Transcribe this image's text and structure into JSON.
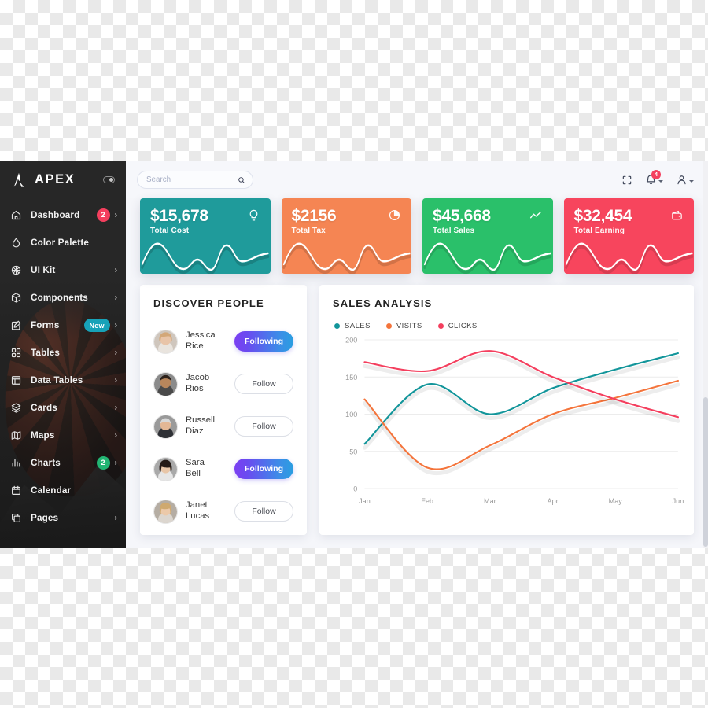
{
  "sidebar": {
    "brand": "APEX",
    "brand_icon": "apex-a-logo",
    "toggle_icon": "sidebar-toggle-switch",
    "items": [
      {
        "label": "Dashboard",
        "icon": "home-icon",
        "badge": "2",
        "badge_color": "#f43f5e",
        "chevron": "›"
      },
      {
        "label": "Color Palette",
        "icon": "droplet-icon",
        "badge": "",
        "badge_color": "",
        "chevron": ""
      },
      {
        "label": "UI Kit",
        "icon": "globe-icon",
        "badge": "",
        "badge_color": "",
        "chevron": "›"
      },
      {
        "label": "Components",
        "icon": "cube-icon",
        "badge": "",
        "badge_color": "",
        "chevron": "›"
      },
      {
        "label": "Forms",
        "icon": "edit-square-icon",
        "badge": "New",
        "badge_color": "#17a2b8",
        "chevron": "›"
      },
      {
        "label": "Tables",
        "icon": "grid-icon",
        "badge": "",
        "badge_color": "",
        "chevron": "›"
      },
      {
        "label": "Data Tables",
        "icon": "layout-icon",
        "badge": "",
        "badge_color": "",
        "chevron": "›"
      },
      {
        "label": "Cards",
        "icon": "layers-icon",
        "badge": "",
        "badge_color": "",
        "chevron": "›"
      },
      {
        "label": "Maps",
        "icon": "map-icon",
        "badge": "",
        "badge_color": "",
        "chevron": "›"
      },
      {
        "label": "Charts",
        "icon": "bar-chart-icon",
        "badge": "2",
        "badge_color": "#22b573",
        "chevron": "›"
      },
      {
        "label": "Calendar",
        "icon": "calendar-icon",
        "badge": "",
        "badge_color": "",
        "chevron": ""
      },
      {
        "label": "Pages",
        "icon": "copy-icon",
        "badge": "",
        "badge_color": "",
        "chevron": "›"
      }
    ]
  },
  "topbar": {
    "search_placeholder": "Search",
    "search_value": "",
    "search_icon": "search-icon",
    "fullscreen_icon": "fullscreen-icon",
    "bell_icon": "bell-icon",
    "bell_count": "4",
    "user_icon": "user-icon"
  },
  "stats": [
    {
      "value": "$15,678",
      "label": "Total Cost",
      "color": "#1f9b9b",
      "icon": "lightbulb-icon"
    },
    {
      "value": "$2156",
      "label": "Total Tax",
      "color": "#f58553",
      "icon": "pie-chart-icon"
    },
    {
      "value": "$45,668",
      "label": "Total Sales",
      "color": "#2ac06a",
      "icon": "trend-line-icon"
    },
    {
      "value": "$32,454",
      "label": "Total Earning",
      "color": "#f7455d",
      "icon": "wallet-icon"
    }
  ],
  "discover": {
    "title": "DISCOVER PEOPLE",
    "people": [
      {
        "first": "Jessica",
        "last": "Rice",
        "action": "Following",
        "state": "following",
        "avatar": "avatar-jessica-rice"
      },
      {
        "first": "Jacob",
        "last": "Rios",
        "action": "Follow",
        "state": "follow",
        "avatar": "avatar-jacob-rios"
      },
      {
        "first": "Russell",
        "last": "Diaz",
        "action": "Follow",
        "state": "follow",
        "avatar": "avatar-russell-diaz"
      },
      {
        "first": "Sara",
        "last": "Bell",
        "action": "Following",
        "state": "following",
        "avatar": "avatar-sara-bell"
      },
      {
        "first": "Janet",
        "last": "Lucas",
        "action": "Follow",
        "state": "follow",
        "avatar": "avatar-janet-lucas"
      }
    ]
  },
  "sales": {
    "title": "SALES ANALYSIS"
  },
  "chart_data": {
    "type": "line",
    "title": "SALES ANALYSIS",
    "xlabel": "",
    "ylabel": "",
    "x": [
      "Jan",
      "Feb",
      "Mar",
      "Apr",
      "May",
      "Jun"
    ],
    "categories": [
      "Jan",
      "Feb",
      "Mar",
      "Apr",
      "May",
      "Jun"
    ],
    "ylim": [
      0,
      200
    ],
    "yticks": [
      0,
      50,
      100,
      150,
      200
    ],
    "grid": true,
    "legend_position": "top-left",
    "smoothing": "spline",
    "series": [
      {
        "name": "SALES",
        "color": "#12959a",
        "values": [
          60,
          140,
          100,
          135,
          160,
          182
        ]
      },
      {
        "name": "VISITS",
        "color": "#f4743b",
        "values": [
          120,
          28,
          58,
          100,
          122,
          145
        ]
      },
      {
        "name": "CLICKS",
        "color": "#f43f5e",
        "values": [
          170,
          158,
          185,
          150,
          120,
          96
        ]
      }
    ]
  }
}
